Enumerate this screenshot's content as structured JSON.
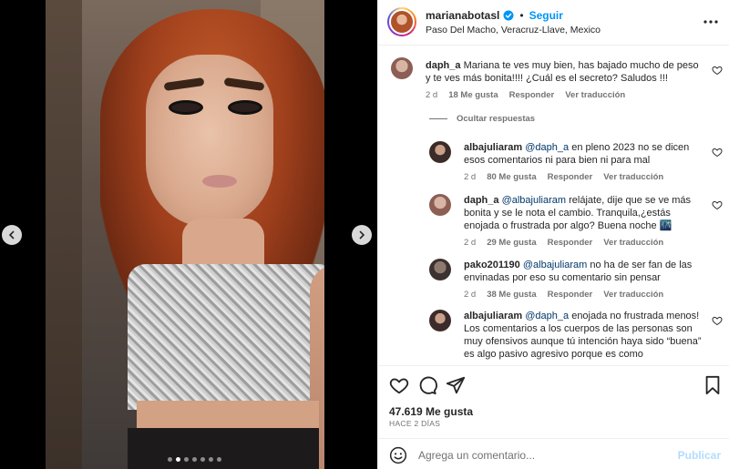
{
  "post": {
    "owner": "marianabotasl",
    "separator": "•",
    "follow_label": "Seguir",
    "location": "Paso Del Macho, Veracruz-Llave, Mexico",
    "likes": "47.619 Me gusta",
    "time_ago": "HACE 2 DÍAS",
    "carousel": {
      "total": 7,
      "active_index": 1
    }
  },
  "comments": [
    {
      "user": "daph_a",
      "text": "Mariana te ves muy bien, has bajado mucho de peso y te ves más bonita!!!! ¿Cuál es el secreto? Saludos !!!",
      "age": "2 d",
      "likes": "18 Me gusta",
      "reply": "Responder",
      "translate": "Ver traducción"
    }
  ],
  "hide_replies_label": "Ocultar respuestas",
  "replies": [
    {
      "user": "albajuliaram",
      "mention": "@daph_a",
      "text": " en pleno 2023 no se dicen esos comentarios ni para bien ni para mal",
      "age": "2 d",
      "likes": "80 Me gusta",
      "reply": "Responder",
      "translate": "Ver traducción"
    },
    {
      "user": "daph_a",
      "mention": "@albajuliaram",
      "text": " relájate, dije que se ve más bonita y se le nota el cambio. Tranquila,¿estás enojada o frustrada por algo? Buena noche 🌃",
      "age": "2 d",
      "likes": "29 Me gusta",
      "reply": "Responder",
      "translate": "Ver traducción"
    },
    {
      "user": "pako201190",
      "mention": "@albajuliaram",
      "text": " no ha de ser fan de las envinadas por eso su comentario sin pensar",
      "age": "2 d",
      "likes": "38 Me gusta",
      "reply": "Responder",
      "translate": "Ver traducción"
    },
    {
      "user": "albajuliaram",
      "mention": "@daph_a",
      "text": " enojada no frustrada menos! Los comentarios a los cuerpos de las personas son muy ofensivos aunque tú intención haya sido “buena” es algo pasivo agresivo porque es como",
      "age": "",
      "likes": "",
      "reply": "",
      "translate": ""
    }
  ],
  "add_comment": {
    "placeholder": "Agrega un comentario...",
    "post_label": "Publicar"
  },
  "icons": {
    "verified": "verified-badge-icon",
    "more": "more-options-icon",
    "like": "heart-icon",
    "comment": "comment-icon",
    "share": "share-icon",
    "save": "bookmark-icon",
    "emoji": "emoji-icon",
    "prev": "chevron-left-icon",
    "next": "chevron-right-icon"
  },
  "colors": {
    "accent": "#0095f6",
    "mention": "#00376b",
    "muted": "#737373",
    "post_disabled": "#b3dbff"
  }
}
